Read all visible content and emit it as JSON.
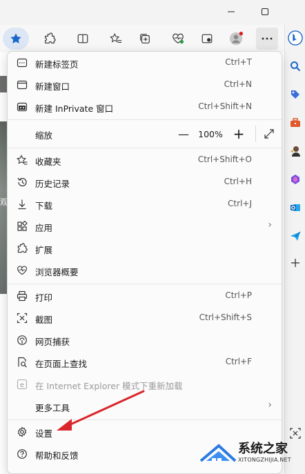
{
  "window": {
    "minimize_icon": "minimize-icon",
    "maximize_icon": "maximize-icon"
  },
  "toolbar": {
    "buttons": [
      "favorites-star-icon",
      "extensions-icon",
      "split-screen-icon",
      "favorites-add-icon",
      "collections-icon",
      "browser-essentials-icon",
      "screenshot-icon",
      "profile-icon",
      "more-icon"
    ]
  },
  "menu": {
    "new_tab": {
      "label": "新建标签页",
      "shortcut": "Ctrl+T"
    },
    "new_window": {
      "label": "新建窗口",
      "shortcut": "Ctrl+N"
    },
    "new_inprivate": {
      "label": "新建 InPrivate 窗口",
      "shortcut": "Ctrl+Shift+N"
    },
    "zoom": {
      "label": "缩放",
      "minus": "—",
      "value": "100%",
      "plus": "+"
    },
    "favorites": {
      "label": "收藏夹",
      "shortcut": "Ctrl+Shift+O"
    },
    "history": {
      "label": "历史记录",
      "shortcut": "Ctrl+H"
    },
    "downloads": {
      "label": "下载",
      "shortcut": "Ctrl+J"
    },
    "apps": {
      "label": "应用"
    },
    "extensions": {
      "label": "扩展"
    },
    "essentials": {
      "label": "浏览器概要"
    },
    "print": {
      "label": "打印",
      "shortcut": "Ctrl+P"
    },
    "screenshot": {
      "label": "截图",
      "shortcut": "Ctrl+Shift+S"
    },
    "web_capture": {
      "label": "网页捕获"
    },
    "find": {
      "label": "在页面上查找",
      "shortcut": "Ctrl+F"
    },
    "ie_mode": {
      "label": "在 Internet Explorer 模式下重新加载"
    },
    "more_tools": {
      "label": "更多工具"
    },
    "settings": {
      "label": "设置"
    },
    "help": {
      "label": "帮助和反馈"
    }
  },
  "page_fragment": {
    "text": "观"
  },
  "watermark": {
    "brand": "系统之家",
    "url": "XITONGZHIJIA.NET"
  },
  "colors": {
    "accent": "#1a66c9",
    "arrow": "#d9262b"
  }
}
